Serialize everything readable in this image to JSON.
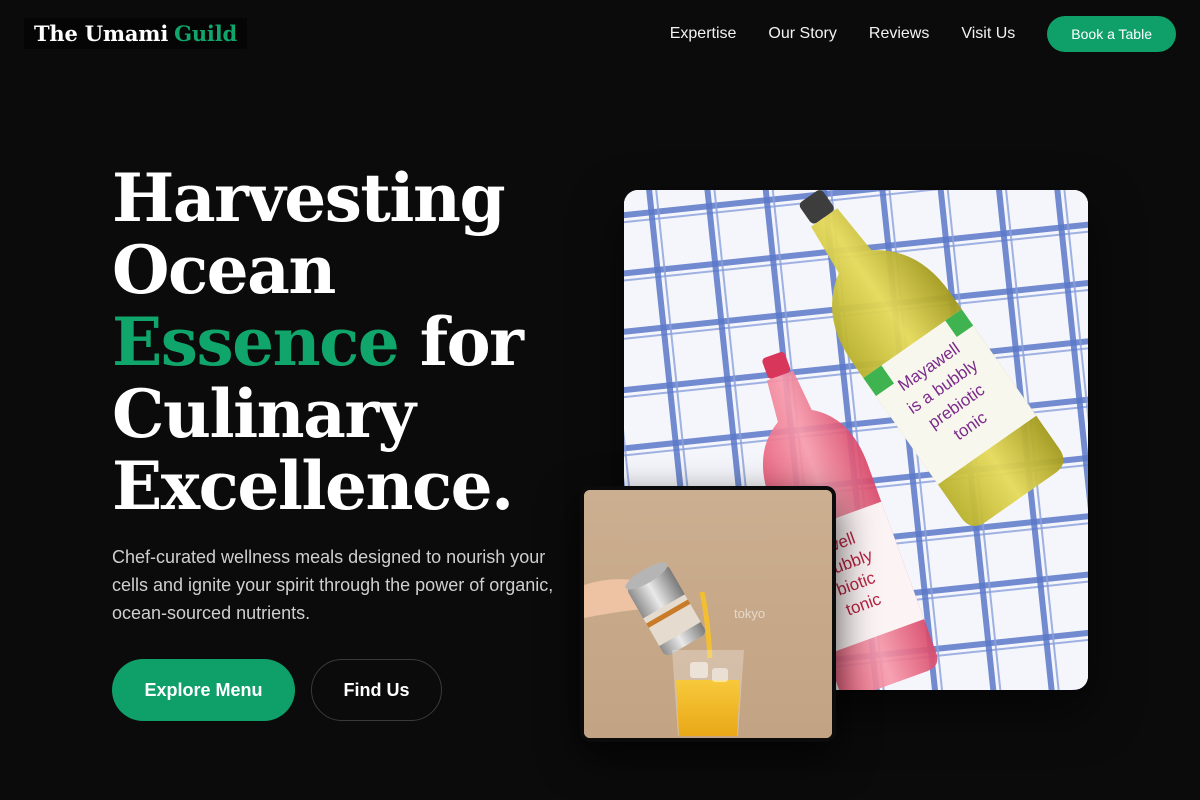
{
  "brand": {
    "name_main": "The Umami",
    "name_accent": "Guild"
  },
  "nav": {
    "links": [
      "Expertise",
      "Our Story",
      "Reviews",
      "Visit Us"
    ],
    "cta_label": "Book a Table"
  },
  "hero": {
    "title_line1": "Harvesting",
    "title_line2": "Ocean",
    "title_accent": "Essence",
    "title_after_accent": "for",
    "title_line4": "Culinary",
    "title_line5": "Excellence.",
    "subtitle": "Chef-curated wellness meals designed to nourish your cells and ignite your spirit through the power of organic, ocean-sourced nutrients.",
    "primary_cta": "Explore Menu",
    "secondary_cta": "Find Us"
  },
  "images": {
    "main_bottle_label_1": "Mayawell",
    "main_bottle_label_2": "is a bubbly",
    "main_bottle_label_3": "prebiotic",
    "main_bottle_label_4": "tonic",
    "pink_bottle_label_1": "well",
    "pink_bottle_label_2": "bubbly",
    "pink_bottle_label_3": "biotic",
    "pink_bottle_label_4": "tonic",
    "small_watermark": "tokyo"
  },
  "colors": {
    "background": "#0b0b0c",
    "accent": "#10a56b",
    "button": "#0fa06a",
    "text_muted": "#cfcfcf"
  }
}
